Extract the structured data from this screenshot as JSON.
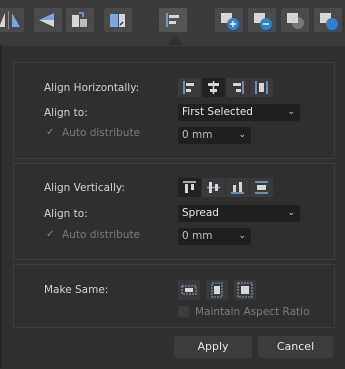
{
  "toolbar": {
    "buttons": [
      {
        "name": "flip-horizontal-icon"
      },
      {
        "name": "flip-vertical-icon"
      },
      {
        "name": "move-forward-icon"
      },
      {
        "name": "move-backward-icon"
      },
      {
        "name": "alignment-icon",
        "active": true
      },
      {
        "name": "add-shape-icon"
      },
      {
        "name": "subtract-shape-icon"
      },
      {
        "name": "intersect-shape-icon"
      },
      {
        "name": "divide-shape-icon"
      }
    ]
  },
  "horizontal": {
    "title": "Align Horizontally:",
    "align_to_label": "Align to:",
    "align_to_value": "First Selected",
    "auto_distribute_label": "Auto distribute",
    "spacing_value": "0 mm"
  },
  "vertical": {
    "title": "Align Vertically:",
    "align_to_label": "Align to:",
    "align_to_value": "Spread",
    "auto_distribute_label": "Auto distribute",
    "spacing_value": "0 mm"
  },
  "make_same": {
    "title": "Make Same:",
    "maintain_aspect_label": "Maintain Aspect Ratio"
  },
  "footer": {
    "apply_label": "Apply",
    "cancel_label": "Cancel"
  },
  "colors": {
    "accent": "#4a90d9",
    "badge_add": "#2f7fd6",
    "badge_subtract": "#2f7fd6"
  }
}
